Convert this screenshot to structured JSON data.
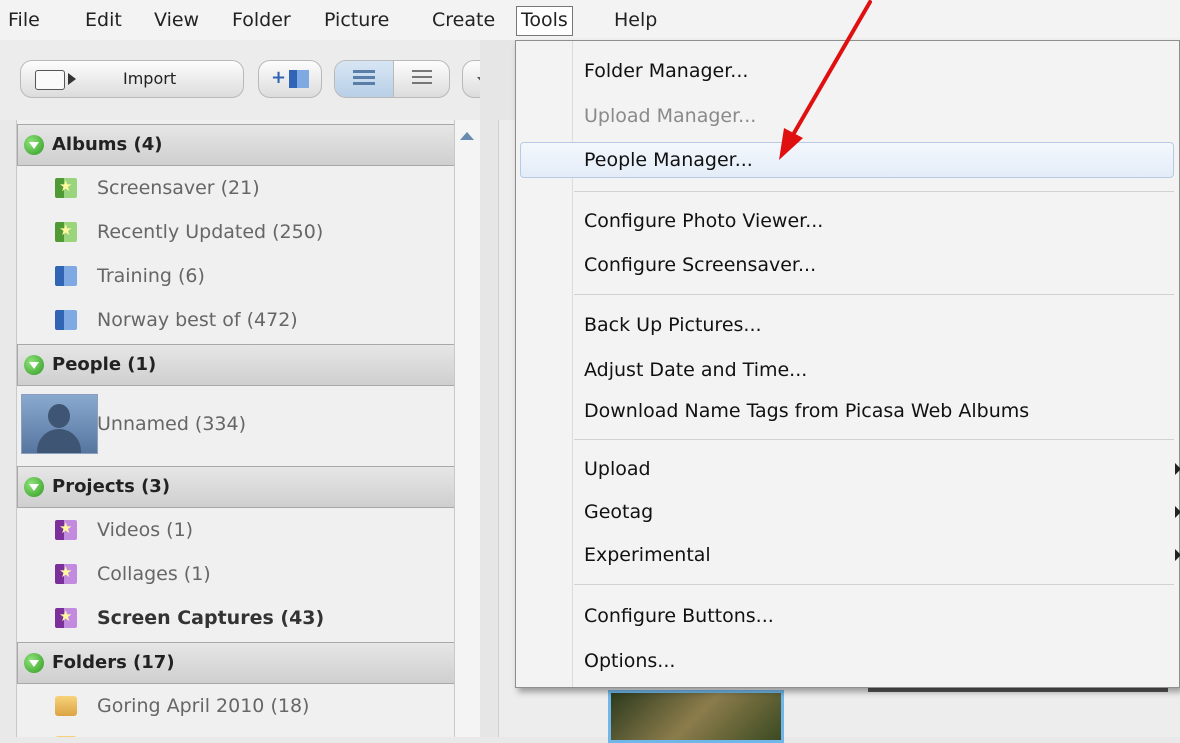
{
  "menubar": {
    "items": [
      "File",
      "Edit",
      "View",
      "Folder",
      "Picture",
      "Create",
      "Tools",
      "Help"
    ]
  },
  "toolbar": {
    "import_label": "Import"
  },
  "sidebar": {
    "albums_header": "Albums (4)",
    "albums": [
      "Screensaver (21)",
      "Recently Updated (250)",
      "Training (6)",
      "Norway best of (472)"
    ],
    "people_header": "People (1)",
    "people": [
      "Unnamed (334)"
    ],
    "projects_header": "Projects (3)",
    "projects": [
      "Videos (1)",
      "Collages (1)",
      "Screen Captures (43)"
    ],
    "folders_header": "Folders (17)",
    "folders": [
      "Goring April 2010 (18)"
    ]
  },
  "tools_menu": {
    "items": [
      "Folder Manager...",
      "Upload Manager...",
      "People Manager...",
      "Configure Photo Viewer...",
      "Configure Screensaver...",
      "Back Up Pictures...",
      "Adjust Date and Time...",
      "Download Name Tags from Picasa Web Albums",
      "Upload",
      "Geotag",
      "Experimental",
      "Configure Buttons...",
      "Options..."
    ]
  },
  "colors": {
    "annotation_arrow": "#e01010",
    "highlight_border": "#b6cbe3",
    "album_green": "#4f9a35",
    "album_blue": "#3264b5",
    "project_purple": "#7a2f9b"
  }
}
